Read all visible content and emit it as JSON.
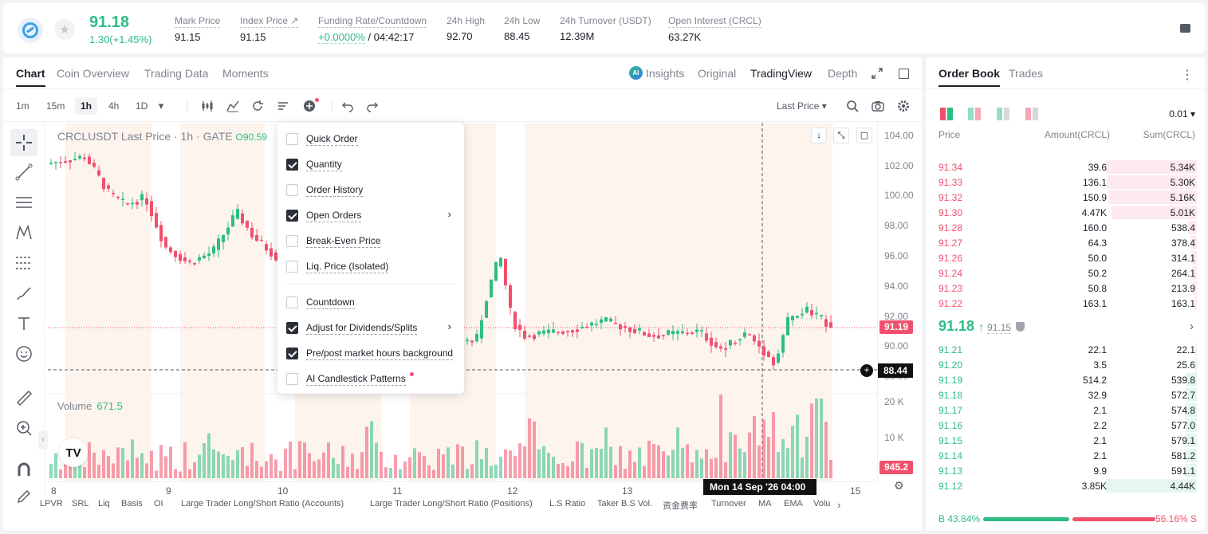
{
  "ticker": {
    "last_price": "91.18",
    "change": "1.30(+1.45%)",
    "stats": [
      {
        "label": "Mark Price",
        "value": "91.15"
      },
      {
        "label": "Index Price ↗",
        "value": "91.15"
      },
      {
        "label": "Funding Rate/Countdown",
        "value_green": "+0.0000%",
        "value": " / 04:42:17"
      },
      {
        "label": "24h High",
        "value": "92.70"
      },
      {
        "label": "24h Low",
        "value": "88.45"
      },
      {
        "label": "24h Turnover (USDT)",
        "value": "12.39M"
      },
      {
        "label": "Open Interest (CRCL)",
        "value": "63.27K"
      }
    ]
  },
  "chart_tabs": [
    "Chart",
    "Coin Overview",
    "Trading Data",
    "Moments"
  ],
  "view_tabs": {
    "ai": "AI",
    "insights": "Insights",
    "original": "Original",
    "tradingview": "TradingView",
    "depth": "Depth"
  },
  "timeframes": [
    "1m",
    "15m",
    "1h",
    "4h",
    "1D"
  ],
  "price_source": "Last Price ▾",
  "chart_header": {
    "title": "CRCLUSDT Last Price · 1h · GATE",
    "open": "O90.59"
  },
  "volume_header": {
    "label": "Volume",
    "value": "671.5"
  },
  "price_axis": [
    "104.00",
    "102.00",
    "100.00",
    "98.00",
    "96.00",
    "94.00",
    "92.00",
    "90.00",
    "88.00",
    "20 K",
    "10 K"
  ],
  "price_tags": {
    "last": "91.19",
    "crosshair": "88.44",
    "volume": "945.2"
  },
  "time_axis": [
    "8",
    "9",
    "10",
    "11",
    "12",
    "13",
    "15"
  ],
  "crosshair_time": "Mon 14 Sep '26   04:00",
  "indicators": [
    "LPVR",
    "SRL",
    "Liq",
    "Basis",
    "OI",
    "Large Trader Long/Short Ratio (Accounts)",
    "Large Trader Long/Short Ratio (Positions)",
    "L.S Ratio",
    "Taker B.S Vol.",
    "资金费率",
    "Turnover",
    "MA",
    "EMA",
    "Volu"
  ],
  "menu": [
    {
      "label": "Quick Order",
      "checked": false,
      "arrow": false
    },
    {
      "label": "Quantity",
      "checked": true,
      "arrow": false
    },
    {
      "label": "Order History",
      "checked": false,
      "arrow": false
    },
    {
      "label": "Open Orders",
      "checked": true,
      "arrow": true
    },
    {
      "label": "Break-Even Price",
      "checked": false,
      "arrow": false
    },
    {
      "label": "Liq. Price (Isolated)",
      "checked": false,
      "arrow": false
    },
    {
      "label": "Countdown",
      "checked": false,
      "arrow": false
    },
    {
      "label": "Adjust for Dividends/Splits",
      "checked": true,
      "arrow": true
    },
    {
      "label": "Pre/post market hours background",
      "checked": true,
      "arrow": false
    },
    {
      "label": "AI Candlestick Patterns",
      "checked": false,
      "arrow": false
    }
  ],
  "orderbook": {
    "tabs": [
      "Order Book",
      "Trades"
    ],
    "precision": "0.01 ▾",
    "headers": {
      "price": "Price",
      "amount": "Amount(CRCL)",
      "sum": "Sum(CRCL)"
    },
    "asks": [
      {
        "price": "91.34",
        "amount": "39.6",
        "sum": "5.34K",
        "depth": 1.0
      },
      {
        "price": "91.33",
        "amount": "136.1",
        "sum": "5.30K",
        "depth": 0.99
      },
      {
        "price": "91.32",
        "amount": "150.9",
        "sum": "5.16K",
        "depth": 0.97
      },
      {
        "price": "91.30",
        "amount": "4.47K",
        "sum": "5.01K",
        "depth": 0.94
      },
      {
        "price": "91.28",
        "amount": "160.0",
        "sum": "538.4",
        "depth": 0.1
      },
      {
        "price": "91.27",
        "amount": "64.3",
        "sum": "378.4",
        "depth": 0.07
      },
      {
        "price": "91.26",
        "amount": "50.0",
        "sum": "314.1",
        "depth": 0.06
      },
      {
        "price": "91.24",
        "amount": "50.2",
        "sum": "264.1",
        "depth": 0.05
      },
      {
        "price": "91.23",
        "amount": "50.8",
        "sum": "213.9",
        "depth": 0.04
      },
      {
        "price": "91.22",
        "amount": "163.1",
        "sum": "163.1",
        "depth": 0.03
      }
    ],
    "mid": {
      "price": "91.18",
      "arrow": "↑",
      "mark": "91.15"
    },
    "bids": [
      {
        "price": "91.21",
        "amount": "22.1",
        "sum": "22.1",
        "depth": 0.005
      },
      {
        "price": "91.20",
        "amount": "3.5",
        "sum": "25.6",
        "depth": 0.006
      },
      {
        "price": "91.19",
        "amount": "514.2",
        "sum": "539.8",
        "depth": 0.12
      },
      {
        "price": "91.18",
        "amount": "32.9",
        "sum": "572.7",
        "depth": 0.13
      },
      {
        "price": "91.17",
        "amount": "2.1",
        "sum": "574.8",
        "depth": 0.13
      },
      {
        "price": "91.16",
        "amount": "2.2",
        "sum": "577.0",
        "depth": 0.13
      },
      {
        "price": "91.15",
        "amount": "2.1",
        "sum": "579.1",
        "depth": 0.13
      },
      {
        "price": "91.14",
        "amount": "2.1",
        "sum": "581.2",
        "depth": 0.13
      },
      {
        "price": "91.13",
        "amount": "9.9",
        "sum": "591.1",
        "depth": 0.13
      },
      {
        "price": "91.12",
        "amount": "3.85K",
        "sum": "4.44K",
        "depth": 1.0
      }
    ],
    "ratio": {
      "buy": "B 43.84%",
      "sell": "56.16% S"
    }
  },
  "colors": {
    "up": "#2dbd85",
    "down": "#f0506e"
  }
}
